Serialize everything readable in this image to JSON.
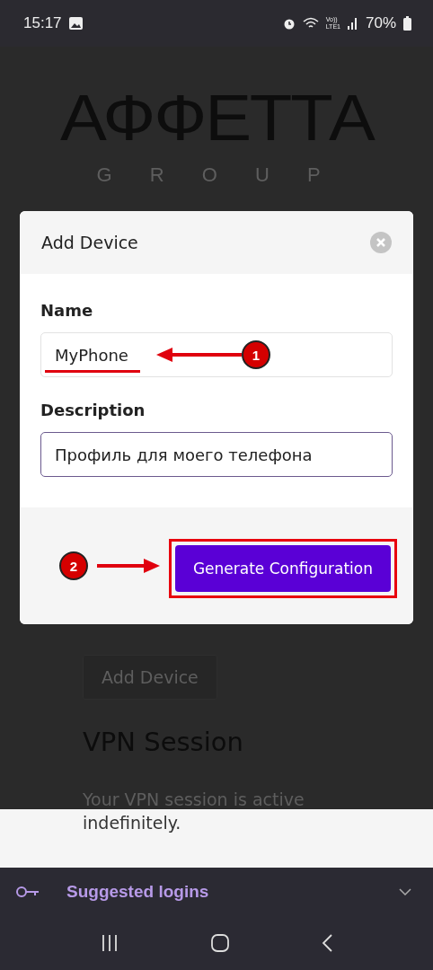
{
  "status_bar": {
    "time": "15:17",
    "volte": "Vo))",
    "network": "LTE1",
    "battery": "70%"
  },
  "logo": {
    "title": "АФФЕТТА",
    "subtitle": "G R O U P"
  },
  "dialog": {
    "title": "Add Device",
    "fields": [
      {
        "label": "Name",
        "value": "MyPhone",
        "annotation": "1",
        "focused": false
      },
      {
        "label": "Description",
        "value": "Профиль для моего телефона",
        "focused": true
      }
    ],
    "button": "Generate Configuration",
    "button_annotation": "2"
  },
  "page": {
    "button": "Add Device",
    "heading": "VPN Session",
    "text_line_1": "Your VPN session is active",
    "text_line_2": "indefinitely."
  },
  "keyboard_bar": {
    "label": "Suggested logins"
  }
}
